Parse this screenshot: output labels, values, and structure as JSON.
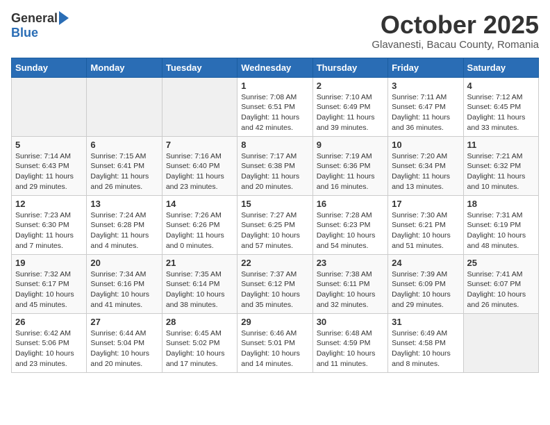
{
  "header": {
    "logo_general": "General",
    "logo_blue": "Blue",
    "month_title": "October 2025",
    "subtitle": "Glavanesti, Bacau County, Romania"
  },
  "days_of_week": [
    "Sunday",
    "Monday",
    "Tuesday",
    "Wednesday",
    "Thursday",
    "Friday",
    "Saturday"
  ],
  "weeks": [
    [
      {
        "day": "",
        "detail": ""
      },
      {
        "day": "",
        "detail": ""
      },
      {
        "day": "",
        "detail": ""
      },
      {
        "day": "1",
        "detail": "Sunrise: 7:08 AM\nSunset: 6:51 PM\nDaylight: 11 hours and 42 minutes."
      },
      {
        "day": "2",
        "detail": "Sunrise: 7:10 AM\nSunset: 6:49 PM\nDaylight: 11 hours and 39 minutes."
      },
      {
        "day": "3",
        "detail": "Sunrise: 7:11 AM\nSunset: 6:47 PM\nDaylight: 11 hours and 36 minutes."
      },
      {
        "day": "4",
        "detail": "Sunrise: 7:12 AM\nSunset: 6:45 PM\nDaylight: 11 hours and 33 minutes."
      }
    ],
    [
      {
        "day": "5",
        "detail": "Sunrise: 7:14 AM\nSunset: 6:43 PM\nDaylight: 11 hours and 29 minutes."
      },
      {
        "day": "6",
        "detail": "Sunrise: 7:15 AM\nSunset: 6:41 PM\nDaylight: 11 hours and 26 minutes."
      },
      {
        "day": "7",
        "detail": "Sunrise: 7:16 AM\nSunset: 6:40 PM\nDaylight: 11 hours and 23 minutes."
      },
      {
        "day": "8",
        "detail": "Sunrise: 7:17 AM\nSunset: 6:38 PM\nDaylight: 11 hours and 20 minutes."
      },
      {
        "day": "9",
        "detail": "Sunrise: 7:19 AM\nSunset: 6:36 PM\nDaylight: 11 hours and 16 minutes."
      },
      {
        "day": "10",
        "detail": "Sunrise: 7:20 AM\nSunset: 6:34 PM\nDaylight: 11 hours and 13 minutes."
      },
      {
        "day": "11",
        "detail": "Sunrise: 7:21 AM\nSunset: 6:32 PM\nDaylight: 11 hours and 10 minutes."
      }
    ],
    [
      {
        "day": "12",
        "detail": "Sunrise: 7:23 AM\nSunset: 6:30 PM\nDaylight: 11 hours and 7 minutes."
      },
      {
        "day": "13",
        "detail": "Sunrise: 7:24 AM\nSunset: 6:28 PM\nDaylight: 11 hours and 4 minutes."
      },
      {
        "day": "14",
        "detail": "Sunrise: 7:26 AM\nSunset: 6:26 PM\nDaylight: 11 hours and 0 minutes."
      },
      {
        "day": "15",
        "detail": "Sunrise: 7:27 AM\nSunset: 6:25 PM\nDaylight: 10 hours and 57 minutes."
      },
      {
        "day": "16",
        "detail": "Sunrise: 7:28 AM\nSunset: 6:23 PM\nDaylight: 10 hours and 54 minutes."
      },
      {
        "day": "17",
        "detail": "Sunrise: 7:30 AM\nSunset: 6:21 PM\nDaylight: 10 hours and 51 minutes."
      },
      {
        "day": "18",
        "detail": "Sunrise: 7:31 AM\nSunset: 6:19 PM\nDaylight: 10 hours and 48 minutes."
      }
    ],
    [
      {
        "day": "19",
        "detail": "Sunrise: 7:32 AM\nSunset: 6:17 PM\nDaylight: 10 hours and 45 minutes."
      },
      {
        "day": "20",
        "detail": "Sunrise: 7:34 AM\nSunset: 6:16 PM\nDaylight: 10 hours and 41 minutes."
      },
      {
        "day": "21",
        "detail": "Sunrise: 7:35 AM\nSunset: 6:14 PM\nDaylight: 10 hours and 38 minutes."
      },
      {
        "day": "22",
        "detail": "Sunrise: 7:37 AM\nSunset: 6:12 PM\nDaylight: 10 hours and 35 minutes."
      },
      {
        "day": "23",
        "detail": "Sunrise: 7:38 AM\nSunset: 6:11 PM\nDaylight: 10 hours and 32 minutes."
      },
      {
        "day": "24",
        "detail": "Sunrise: 7:39 AM\nSunset: 6:09 PM\nDaylight: 10 hours and 29 minutes."
      },
      {
        "day": "25",
        "detail": "Sunrise: 7:41 AM\nSunset: 6:07 PM\nDaylight: 10 hours and 26 minutes."
      }
    ],
    [
      {
        "day": "26",
        "detail": "Sunrise: 6:42 AM\nSunset: 5:06 PM\nDaylight: 10 hours and 23 minutes."
      },
      {
        "day": "27",
        "detail": "Sunrise: 6:44 AM\nSunset: 5:04 PM\nDaylight: 10 hours and 20 minutes."
      },
      {
        "day": "28",
        "detail": "Sunrise: 6:45 AM\nSunset: 5:02 PM\nDaylight: 10 hours and 17 minutes."
      },
      {
        "day": "29",
        "detail": "Sunrise: 6:46 AM\nSunset: 5:01 PM\nDaylight: 10 hours and 14 minutes."
      },
      {
        "day": "30",
        "detail": "Sunrise: 6:48 AM\nSunset: 4:59 PM\nDaylight: 10 hours and 11 minutes."
      },
      {
        "day": "31",
        "detail": "Sunrise: 6:49 AM\nSunset: 4:58 PM\nDaylight: 10 hours and 8 minutes."
      },
      {
        "day": "",
        "detail": ""
      }
    ]
  ]
}
